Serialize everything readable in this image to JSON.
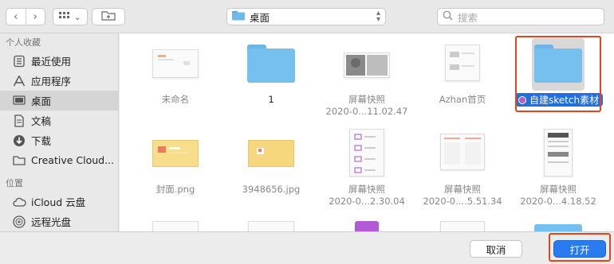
{
  "toolbar": {
    "back": "‹",
    "forward": "›",
    "view_icon": "grid-icon",
    "view_chevron": "⌄",
    "new_folder_icon": "new-folder-icon",
    "location": "桌面",
    "search_placeholder": "搜索"
  },
  "sidebar": {
    "favorites_title": "个人收藏",
    "favorites": [
      {
        "label": "最近使用",
        "icon": "clock-icon"
      },
      {
        "label": "应用程序",
        "icon": "applications-icon"
      },
      {
        "label": "桌面",
        "icon": "desktop-icon",
        "active": true
      },
      {
        "label": "文稿",
        "icon": "document-icon"
      },
      {
        "label": "下载",
        "icon": "download-icon"
      },
      {
        "label": "Creative Cloud...",
        "icon": "folder-icon"
      }
    ],
    "locations_title": "位置",
    "locations": [
      {
        "label": "iCloud 云盘",
        "icon": "cloud-icon"
      },
      {
        "label": "远程光盘",
        "icon": "disc-icon"
      }
    ]
  },
  "files": [
    {
      "name": "未命名",
      "sub": "",
      "kind": "doc"
    },
    {
      "name": "1",
      "sub": "",
      "kind": "folder"
    },
    {
      "name": "屏幕快照",
      "sub": "2020-0...11.02.47",
      "kind": "screenshot"
    },
    {
      "name": "Azhan首页",
      "sub": "",
      "kind": "doc"
    },
    {
      "name": "自建sketch素材",
      "sub": "",
      "kind": "folder",
      "selected": true
    },
    {
      "name": "封面.png",
      "sub": "",
      "kind": "yellow"
    },
    {
      "name": "3948656.jpg",
      "sub": "",
      "kind": "yellow"
    },
    {
      "name": "屏幕快照",
      "sub": "2020-0...2.30.04",
      "kind": "screenshot"
    },
    {
      "name": "屏幕快照",
      "sub": "2020-0....5.51.34",
      "kind": "screenshot"
    },
    {
      "name": "屏幕快照",
      "sub": "2020-0...4.18.52",
      "kind": "screenshot"
    }
  ],
  "buttons": {
    "cancel": "取消",
    "open": "打开"
  },
  "colors": {
    "accent": "#2a7bf0",
    "selection": "#1f6fde",
    "highlight_outline": "#e2461f",
    "folder": "#76c0ef"
  }
}
